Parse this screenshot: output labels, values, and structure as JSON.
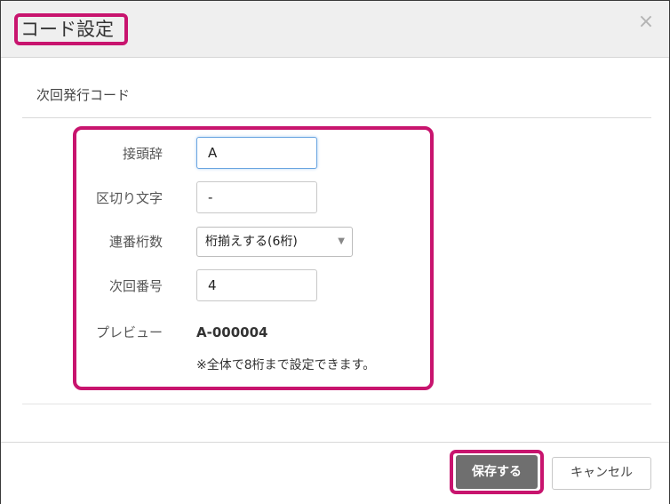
{
  "dialog": {
    "title": "コード設定",
    "close_icon": "×"
  },
  "section": {
    "title": "次回発行コード"
  },
  "form": {
    "prefix": {
      "label": "接頭辞",
      "value": "A"
    },
    "delimiter": {
      "label": "区切り文字",
      "value": "-"
    },
    "digits": {
      "label": "連番桁数",
      "selected": "桁揃えする(6桁)"
    },
    "next_number": {
      "label": "次回番号",
      "value": "4"
    },
    "preview": {
      "label": "プレビュー",
      "value": "A-000004"
    },
    "note": "※全体で8桁まで設定できます。"
  },
  "footer": {
    "save_label": "保存する",
    "cancel_label": "キャンセル"
  },
  "colors": {
    "highlight": "#c8146e",
    "save_button": "#6f6f6f"
  }
}
